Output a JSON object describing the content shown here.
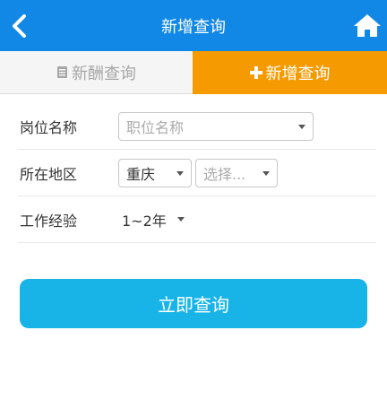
{
  "header": {
    "title": "新增查询",
    "back_icon": "chevron-left-icon",
    "home_icon": "home-icon",
    "bg_color": "#1188e6"
  },
  "tabs": [
    {
      "label": "新酬查询",
      "icon": "document-icon",
      "active": false
    },
    {
      "label": "新增查询",
      "icon": "plus-icon",
      "active": true,
      "active_color": "#f59a00"
    }
  ],
  "form": {
    "position": {
      "label": "岗位名称",
      "placeholder": "职位名称"
    },
    "region": {
      "label": "所在地区",
      "city": "重庆",
      "district_placeholder": "选择..."
    },
    "experience": {
      "label": "工作经验",
      "value": "1~2年"
    }
  },
  "submit": {
    "label": "立即查询",
    "color": "#18b4e8"
  }
}
